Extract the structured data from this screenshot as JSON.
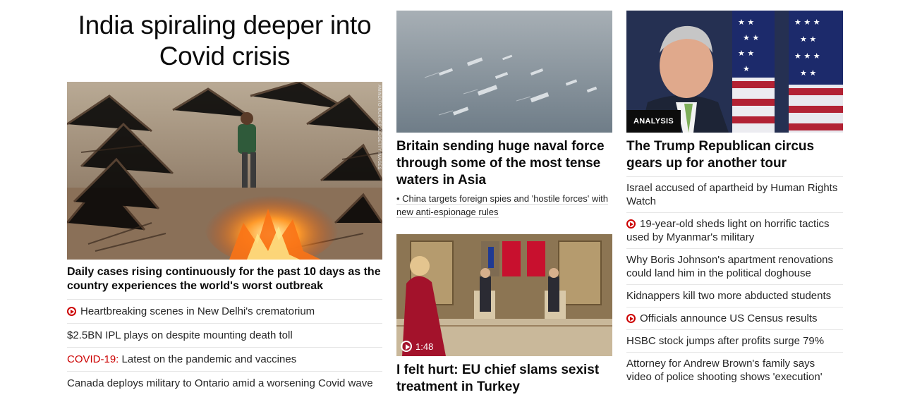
{
  "lead": {
    "headline": "India spiraling deeper into Covid crisis",
    "image_credit": "AMINDITO MUKHERJEE/GETTY IMAGES",
    "image_alt": "Funeral pyres burning at a crematorium",
    "subheadline": "Daily cases rising continuously for the past 10 days as the country experiences the world's worst outbreak",
    "links": [
      {
        "video": true,
        "prefix": "",
        "text": "Heartbreaking scenes in New Delhi's crematorium"
      },
      {
        "video": false,
        "prefix": "",
        "text": "$2.5BN IPL plays on despite mounting death toll"
      },
      {
        "video": false,
        "prefix": "COVID-19:",
        "text": " Latest on the pandemic and vaccines"
      },
      {
        "video": false,
        "prefix": "",
        "text": "Canada deploys military to Ontario amid a worsening Covid wave"
      }
    ]
  },
  "middle": {
    "story1": {
      "image_alt": "Naval fleet at sea",
      "headline": "Britain sending huge naval force through some of the most tense waters in Asia",
      "sublink": "• China targets foreign spies and 'hostile forces' with new anti-espionage rules"
    },
    "story2": {
      "image_alt": "EU chief standing in meeting room in Turkey",
      "video_duration": "1:48",
      "headline": "I felt hurt: EU chief slams sexist treatment in Turkey"
    }
  },
  "right": {
    "image_alt": "Politician in front of American flags",
    "tag": "ANALYSIS",
    "headline": "The Trump Republican circus gears up for another tour",
    "links": [
      {
        "video": false,
        "text": "Israel accused of apartheid by Human Rights Watch"
      },
      {
        "video": true,
        "text": "19-year-old sheds light on horrific tactics used by Myanmar's military"
      },
      {
        "video": false,
        "text": "Why Boris Johnson's apartment renovations could land him in the political doghouse"
      },
      {
        "video": false,
        "text": "Kidnappers kill two more abducted students"
      },
      {
        "video": true,
        "text": "Officials announce US Census results"
      },
      {
        "video": false,
        "text": "HSBC stock jumps after profits surge 79%"
      },
      {
        "video": false,
        "text": "Attorney for Andrew Brown's family says video of police shooting shows 'execution'"
      }
    ]
  },
  "colors": {
    "accent_red": "#cc0000",
    "text": "#0c0c0c",
    "divider": "#e6e6e6"
  }
}
